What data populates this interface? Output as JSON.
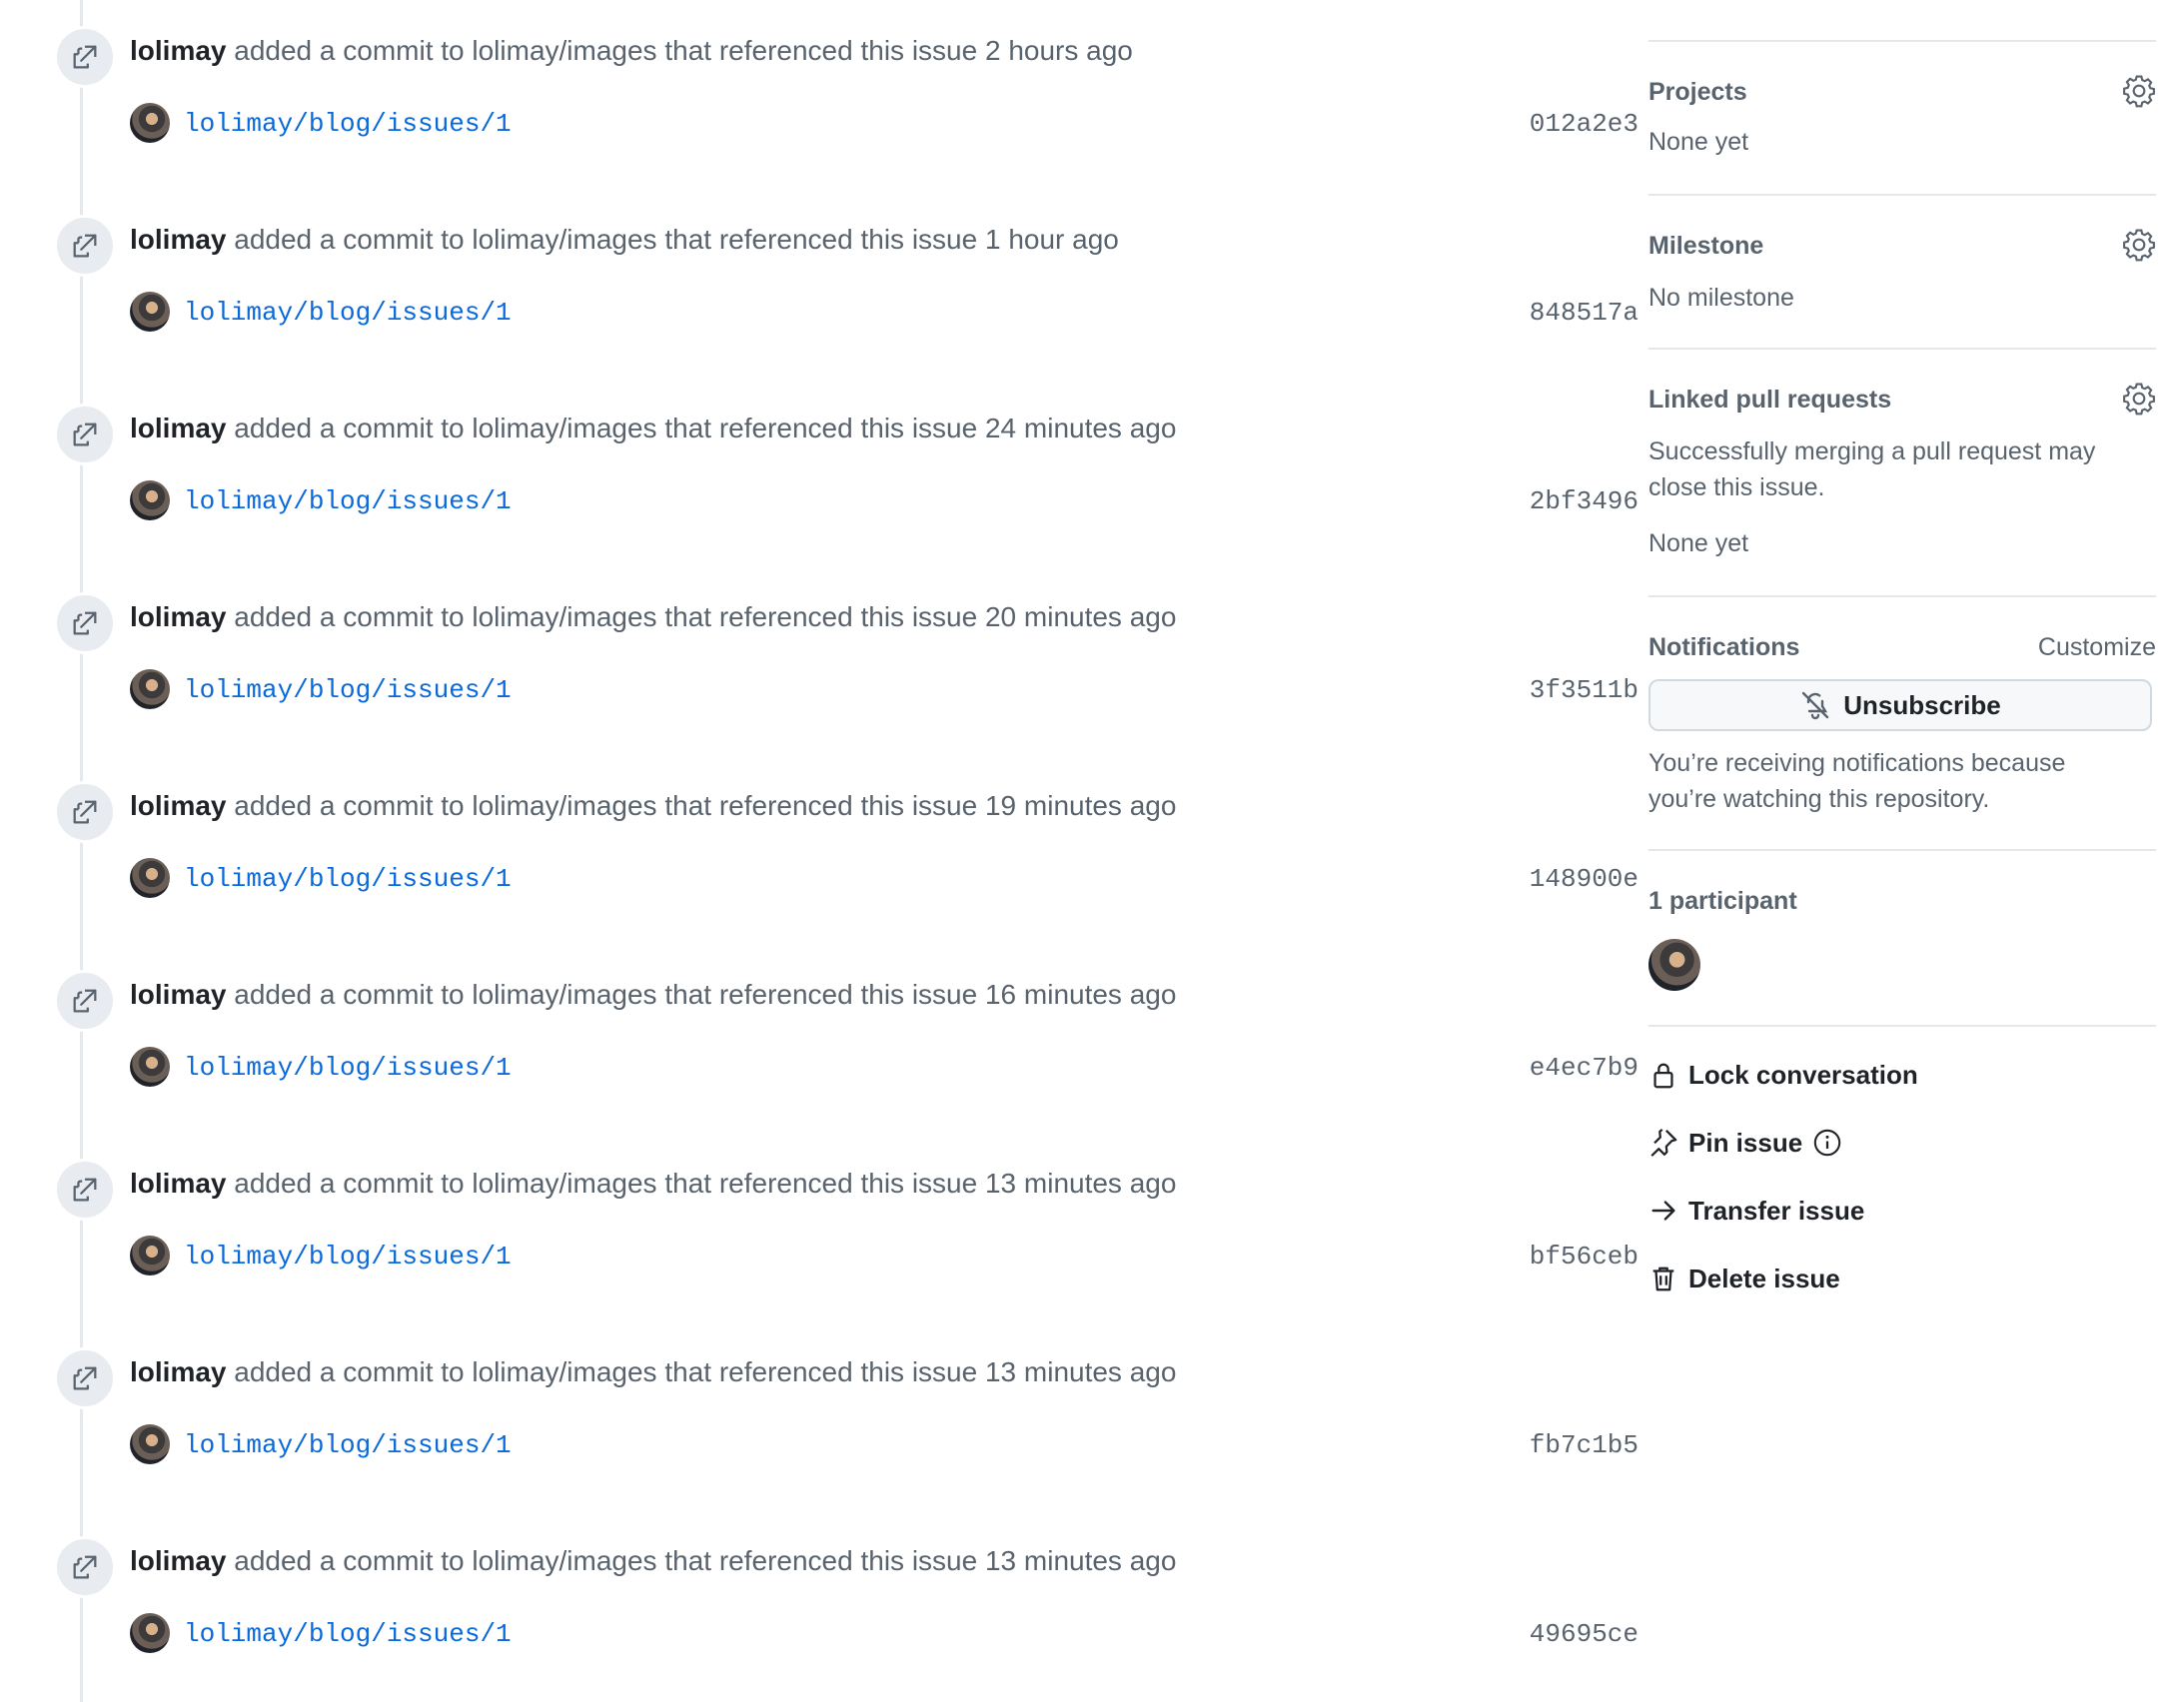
{
  "timeline": {
    "events": [
      {
        "author": "lolimay",
        "action_text": "added a commit to lolimay/images that referenced this issue",
        "time": "2 hours ago",
        "commit_message": "lolimay/blog/issues/1",
        "sha": "012a2e3"
      },
      {
        "author": "lolimay",
        "action_text": "added a commit to lolimay/images that referenced this issue",
        "time": "1 hour ago",
        "commit_message": "lolimay/blog/issues/1",
        "sha": "848517a"
      },
      {
        "author": "lolimay",
        "action_text": "added a commit to lolimay/images that referenced this issue",
        "time": "24 minutes ago",
        "commit_message": "lolimay/blog/issues/1",
        "sha": "2bf3496"
      },
      {
        "author": "lolimay",
        "action_text": "added a commit to lolimay/images that referenced this issue",
        "time": "20 minutes ago",
        "commit_message": "lolimay/blog/issues/1",
        "sha": "3f3511b"
      },
      {
        "author": "lolimay",
        "action_text": "added a commit to lolimay/images that referenced this issue",
        "time": "19 minutes ago",
        "commit_message": "lolimay/blog/issues/1",
        "sha": "148900e"
      },
      {
        "author": "lolimay",
        "action_text": "added a commit to lolimay/images that referenced this issue",
        "time": "16 minutes ago",
        "commit_message": "lolimay/blog/issues/1",
        "sha": "e4ec7b9"
      },
      {
        "author": "lolimay",
        "action_text": "added a commit to lolimay/images that referenced this issue",
        "time": "13 minutes ago",
        "commit_message": "lolimay/blog/issues/1",
        "sha": "bf56ceb"
      },
      {
        "author": "lolimay",
        "action_text": "added a commit to lolimay/images that referenced this issue",
        "time": "13 minutes ago",
        "commit_message": "lolimay/blog/issues/1",
        "sha": "fb7c1b5"
      },
      {
        "author": "lolimay",
        "action_text": "added a commit to lolimay/images that referenced this issue",
        "time": "13 minutes ago",
        "commit_message": "lolimay/blog/issues/1",
        "sha": "49695ce"
      }
    ]
  },
  "sidebar": {
    "projects": {
      "heading": "Projects",
      "value": "None yet"
    },
    "milestone": {
      "heading": "Milestone",
      "value": "No milestone"
    },
    "linked_prs": {
      "heading": "Linked pull requests",
      "description": "Successfully merging a pull request may close this issue.",
      "value": "None yet"
    },
    "notifications": {
      "heading": "Notifications",
      "customize": "Customize",
      "unsubscribe_label": "Unsubscribe",
      "reason": "You’re receiving notifications because you’re watching this repository."
    },
    "participants": {
      "heading": "1 participant"
    },
    "actions": {
      "lock": "Lock conversation",
      "pin": "Pin issue",
      "transfer": "Transfer issue",
      "delete": "Delete issue"
    }
  },
  "colors": {
    "link": "#0969da",
    "muted": "#59636e",
    "text": "#1f2328",
    "badge_bg": "#e8ebef"
  },
  "icons": {
    "event": "cross-reference-icon",
    "settings": "gear-icon",
    "unsubscribe": "bell-slash-icon",
    "lock": "lock-icon",
    "pin": "pin-icon",
    "info": "info-icon",
    "transfer": "arrow-right-icon",
    "delete": "trash-icon"
  }
}
